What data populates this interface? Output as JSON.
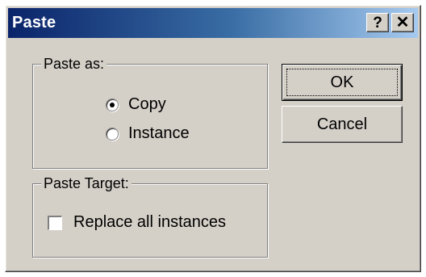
{
  "window": {
    "title": "Paste",
    "help_button": "?",
    "close_button": "✕"
  },
  "paste_as": {
    "label": "Paste as:",
    "options": [
      {
        "label": "Copy",
        "selected": true
      },
      {
        "label": "Instance",
        "selected": false
      }
    ]
  },
  "paste_target": {
    "label": "Paste Target:",
    "replace_all": {
      "label": "Replace all instances",
      "checked": false
    }
  },
  "buttons": {
    "ok": "OK",
    "cancel": "Cancel"
  },
  "colors": {
    "face": "#d4d0c8",
    "title_start": "#0a246a",
    "title_end": "#a6caf0"
  }
}
